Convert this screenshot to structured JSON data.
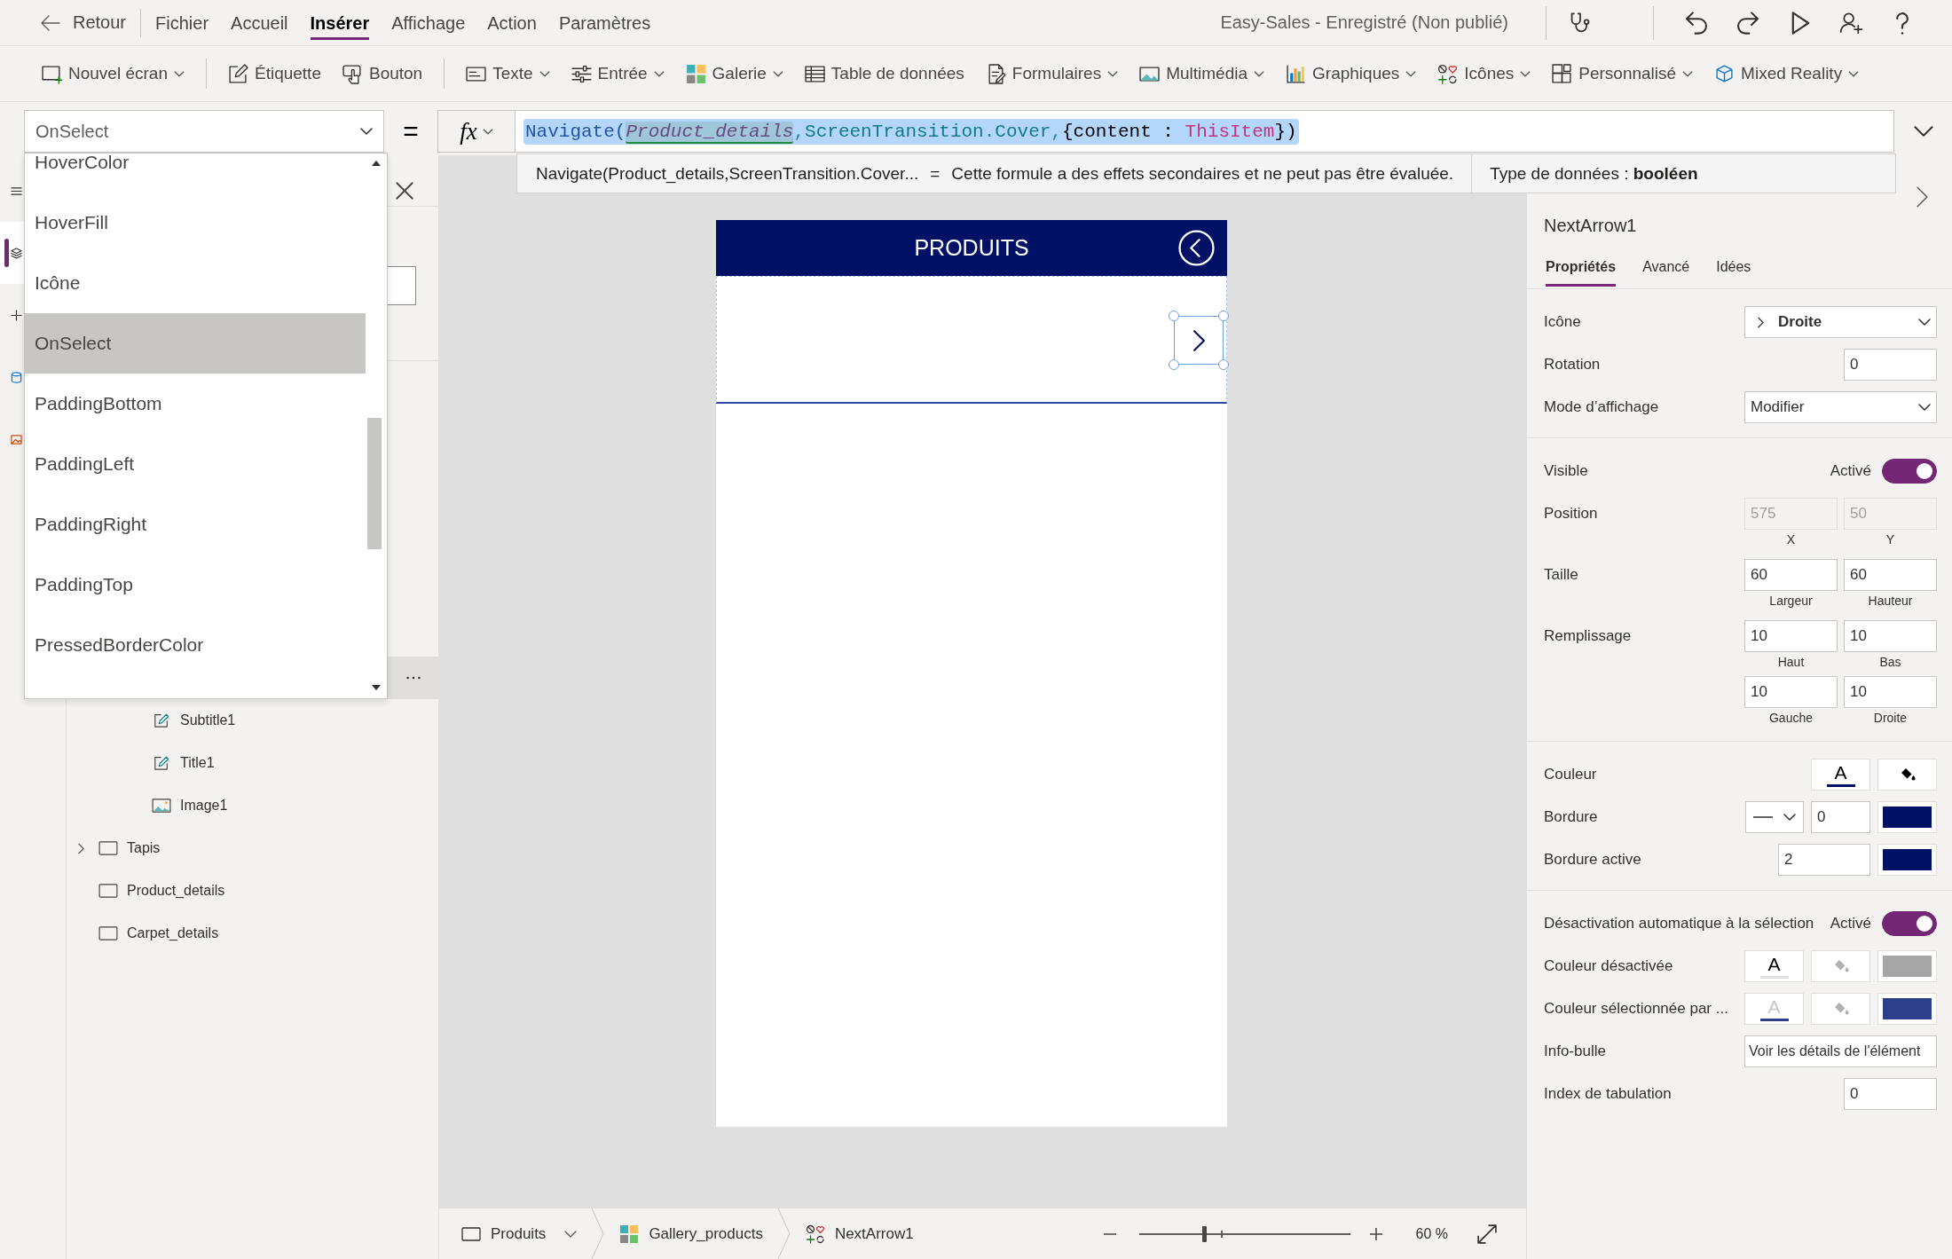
{
  "menu_bar": {
    "back": "Retour",
    "tabs": [
      {
        "label": "Fichier",
        "selected": false
      },
      {
        "label": "Accueil",
        "selected": false
      },
      {
        "label": "Insérer",
        "selected": true
      },
      {
        "label": "Affichage",
        "selected": false
      },
      {
        "label": "Action",
        "selected": false
      },
      {
        "label": "Paramètres",
        "selected": false
      }
    ],
    "app_status": "Easy-Sales - Enregistré (Non publié)"
  },
  "toolbar": {
    "groups": [
      [
        {
          "kind": "new-screen",
          "label": "Nouvel écran",
          "dropdown": true
        }
      ],
      [
        {
          "kind": "label",
          "label": "Étiquette",
          "dropdown": false
        },
        {
          "kind": "button",
          "label": "Bouton",
          "dropdown": false
        }
      ],
      [
        {
          "kind": "text",
          "label": "Texte",
          "dropdown": true
        },
        {
          "kind": "input",
          "label": "Entrée",
          "dropdown": true
        },
        {
          "kind": "gallery",
          "label": "Galerie",
          "dropdown": true
        },
        {
          "kind": "table",
          "label": "Table de données",
          "dropdown": false
        },
        {
          "kind": "forms",
          "label": "Formulaires",
          "dropdown": true
        },
        {
          "kind": "media",
          "label": "Multimédia",
          "dropdown": true
        },
        {
          "kind": "charts",
          "label": "Graphiques",
          "dropdown": true
        },
        {
          "kind": "icons",
          "label": "Icônes",
          "dropdown": true
        },
        {
          "kind": "custom",
          "label": "Personnalisé",
          "dropdown": true
        },
        {
          "kind": "mixed-reality",
          "label": "Mixed Reality",
          "dropdown": true
        }
      ]
    ]
  },
  "formula_bar": {
    "property": "OnSelect",
    "equals": "=",
    "fx": "fx",
    "selected": true,
    "tokens": [
      {
        "text": "Navigate",
        "kind": "function"
      },
      {
        "text": "(",
        "kind": "function"
      },
      {
        "text": "Product_details",
        "kind": "screen"
      },
      {
        "text": ",",
        "kind": "operator"
      },
      {
        "text": "ScreenTransition",
        "kind": "enum"
      },
      {
        "text": ".",
        "kind": "operator"
      },
      {
        "text": "Cover",
        "kind": "enum"
      },
      {
        "text": ",",
        "kind": "operator"
      },
      {
        "text": "{content : ",
        "kind": "plain"
      },
      {
        "text": "ThisItem",
        "kind": "keyword"
      },
      {
        "text": "})",
        "kind": "plain"
      }
    ],
    "hint": {
      "preview": "Navigate(Product_details,ScreenTransition.Cover...",
      "equals": "=",
      "result": "Cette formule a des effets secondaires et ne peut pas être évaluée.",
      "data_type": "Type de données : **booléen**"
    }
  },
  "property_list": {
    "items": [
      {
        "label": "HoverColor",
        "selected": false
      },
      {
        "label": "HoverFill",
        "selected": false
      },
      {
        "label": "Icône",
        "selected": false
      },
      {
        "label": "OnSelect",
        "selected": true
      },
      {
        "label": "PaddingBottom",
        "selected": false
      },
      {
        "label": "PaddingLeft",
        "selected": false
      },
      {
        "label": "PaddingRight",
        "selected": false
      },
      {
        "label": "PaddingTop",
        "selected": false
      },
      {
        "label": "PressedBorderColor",
        "selected": false
      }
    ]
  },
  "nav_rail": {
    "items": [
      {
        "kind": "menu",
        "selected": false
      },
      {
        "kind": "tree",
        "selected": true
      },
      {
        "kind": "insert",
        "selected": false
      },
      {
        "kind": "data",
        "selected": false
      },
      {
        "kind": "media",
        "selected": false
      }
    ]
  },
  "tree_panel": {
    "items": [
      {
        "children": [
          {
            "children": [
              {
                "selected": true
              },
              {
                "label": "Subtitle1",
                "kind": "label",
                "selected": false
              },
              {
                "label": "Title1",
                "kind": "label",
                "selected": false
              },
              {
                "label": "Image1",
                "kind": "image",
                "selected": false
              }
            ]
          }
        ]
      },
      {
        "label": "Tapis",
        "kind": "screen",
        "selected": false,
        "expanded": false
      },
      {
        "label": "Product_details",
        "kind": "screen",
        "selected": false
      },
      {
        "label": "Carpet_details",
        "kind": "screen",
        "selected": false
      }
    ]
  },
  "canvas": {
    "screen": {
      "title": "PRODUITS",
      "gallery": {
        "next_arrow": {
          "selected": true
        }
      }
    }
  },
  "properties_panel": {
    "control_name": "NextArrow1",
    "tabs": [
      {
        "label": "Propriétés",
        "selected": true
      },
      {
        "label": "Avancé",
        "selected": false
      },
      {
        "label": "Idées",
        "selected": false
      }
    ],
    "sections": [
      {
        "rows": [
          {
            "kind": "icon-select",
            "label": "Icône",
            "value": "Droite"
          },
          {
            "kind": "number",
            "label": "Rotation",
            "value": "0"
          },
          {
            "kind": "select",
            "label": "Mode d’affichage",
            "value": "Modifier"
          }
        ]
      },
      {
        "rows": [
          {
            "kind": "toggle",
            "label": "Visible",
            "state_text": "Activé",
            "on": true
          },
          {
            "kind": "fields",
            "label": "Position",
            "fields": [
              {
                "value": "575",
                "caption": "X",
                "disabled": true
              },
              {
                "value": "50",
                "caption": "Y",
                "disabled": true
              }
            ]
          },
          {
            "kind": "fields",
            "label": "Taille",
            "fields": [
              {
                "value": "60",
                "caption": "Largeur",
                "disabled": false
              },
              {
                "value": "60",
                "caption": "Hauteur",
                "disabled": false
              }
            ]
          },
          {
            "kind": "fields",
            "label": "Remplissage",
            "fields": [
              {
                "value": "10",
                "caption": "Haut",
                "disabled": false
              },
              {
                "value": "10",
                "caption": "Bas",
                "disabled": false
              },
              {
                "value": "10",
                "caption": "Gauche",
                "disabled": false
              },
              {
                "value": "10",
                "caption": "Droite",
                "disabled": false
              }
            ]
          }
        ]
      },
      {
        "rows": [
          {
            "kind": "colors",
            "label": "Couleur",
            "swatches": [
              {
                "kind": "letter",
                "text": "A",
                "color": "#001166",
                "faded": false
              },
              {
                "kind": "bucket",
                "faded": false
              }
            ]
          },
          {
            "kind": "border",
            "label": "Bordure",
            "value": "0",
            "color": "#001166"
          },
          {
            "kind": "number-color",
            "label": "Bordure active",
            "value": "2",
            "color": "#001166"
          }
        ]
      },
      {
        "rows": [
          {
            "kind": "toggle",
            "label": "Désactivation automatique à la sélection",
            "state_text": "Activé",
            "on": true
          },
          {
            "kind": "colors",
            "label": "Couleur désactivée",
            "swatches": [
              {
                "kind": "letter",
                "text": "A",
                "color": "#e1dfdd",
                "faded": false
              },
              {
                "kind": "bucket",
                "faded": true
              },
              {
                "kind": "swatch",
                "color": "#a6a6a6"
              }
            ]
          },
          {
            "kind": "colors",
            "label": "Couleur sélectionnée par ...",
            "swatches": [
              {
                "kind": "letter",
                "text": "A",
                "color": "#2c3e8f",
                "faded": true
              },
              {
                "kind": "bucket",
                "faded": true
              },
              {
                "kind": "swatch",
                "color": "#2d3e8c"
              }
            ]
          },
          {
            "kind": "text",
            "label": "Info-bulle",
            "value": "Voir les détails de l'élément"
          },
          {
            "kind": "number",
            "label": "Index de tabulation",
            "value": "0"
          }
        ]
      }
    ]
  },
  "status_bar": {
    "breadcrumbs": [
      {
        "kind": "screen",
        "label": "Produits",
        "dropdown": true
      },
      {
        "kind": "gallery",
        "label": "Gallery_products",
        "dropdown": false
      },
      {
        "kind": "icon",
        "label": "NextArrow1",
        "dropdown": false
      }
    ],
    "zoom": {
      "level": 0.31,
      "reading": "60 %"
    }
  }
}
